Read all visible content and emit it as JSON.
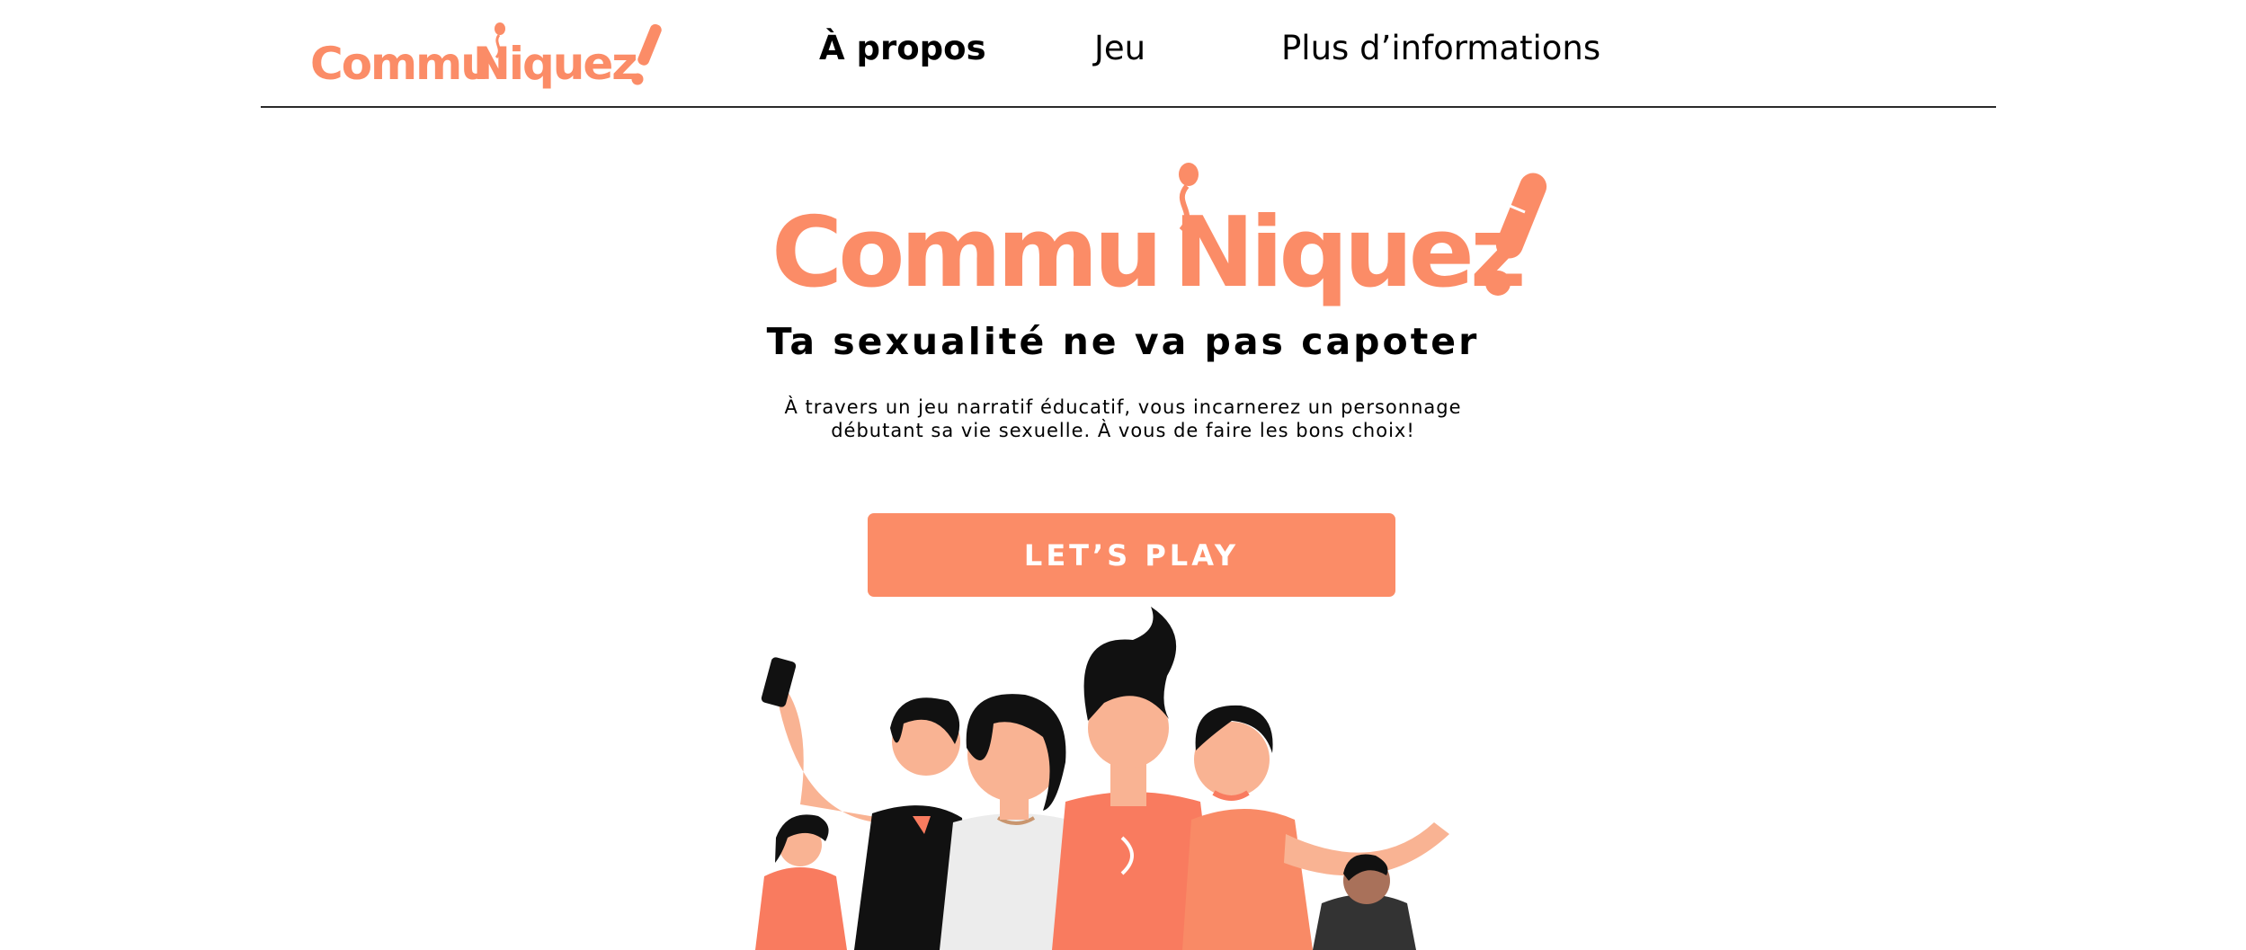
{
  "brand": {
    "name_part1": "Commu",
    "name_part2": "Niquez",
    "exclaim": "!",
    "color": "#fb8c67"
  },
  "nav": {
    "items": [
      {
        "label": "À propos",
        "active": true
      },
      {
        "label": "Jeu",
        "active": false
      },
      {
        "label": "Plus d’informations",
        "active": false
      }
    ]
  },
  "hero": {
    "tagline": "Ta sexualité ne va pas capoter",
    "description_line1": "À travers un jeu narratif éducatif, vous incarnerez un personnage",
    "description_line2": "débutant sa vie sexuelle. À vous de faire les bons choix!",
    "cta_label": "LET’S PLAY"
  },
  "colors": {
    "accent": "#fb8c67",
    "coral_shirt": "#f97b5f",
    "skin": "#f9b393",
    "hair": "#111111",
    "divider": "#2a2a2a"
  }
}
